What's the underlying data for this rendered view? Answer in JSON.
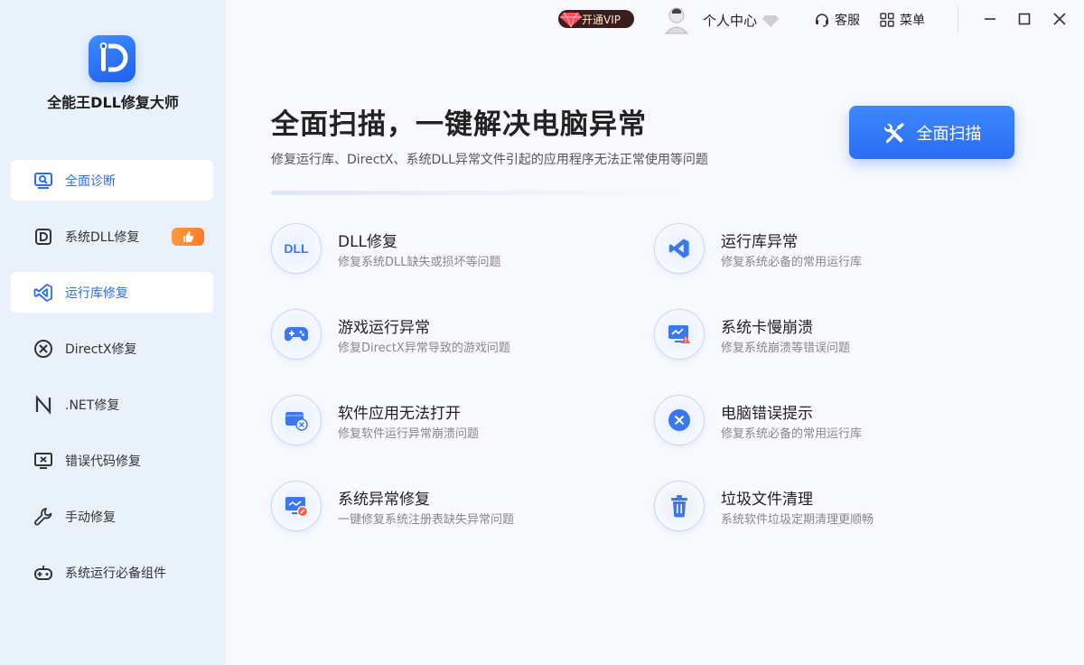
{
  "app": {
    "name": "全能王DLL修复大师"
  },
  "sidebar": {
    "items": [
      {
        "label": "全面诊断",
        "icon": "scan-icon"
      },
      {
        "label": "系统DLL修复",
        "icon": "dll-icon"
      },
      {
        "label": "运行库修复",
        "icon": "vs-icon"
      },
      {
        "label": "DirectX修复",
        "icon": "directx-icon"
      },
      {
        "label": ".NET修复",
        "icon": "dotnet-icon"
      },
      {
        "label": "错误代码修复",
        "icon": "monitor-error-icon"
      },
      {
        "label": "手动修复",
        "icon": "wrench-icon"
      },
      {
        "label": "系统运行必备组件",
        "icon": "gamepad-icon"
      }
    ]
  },
  "topbar": {
    "vip_label": "开通VIP",
    "user_center": "个人中心",
    "service": "客服",
    "menu": "菜单"
  },
  "main": {
    "headline": "全面扫描，一键解决电脑异常",
    "subline": "修复运行库、DirectX、系统DLL异常文件引起的应用程序无法正常使用等问题",
    "scan_button": "全面扫描",
    "features": [
      {
        "title": "DLL修复",
        "desc": "修复系统DLL缺失或损坏等问题",
        "icon": "dll-text-icon",
        "icon_text": "DLL"
      },
      {
        "title": "运行库异常",
        "desc": "修复系统必备的常用运行库",
        "icon": "vs-icon"
      },
      {
        "title": "游戏运行异常",
        "desc": "修复DirectX异常导致的游戏问题",
        "icon": "gamepad-icon"
      },
      {
        "title": "系统卡慢崩溃",
        "desc": "修复系统崩溃等错误问题",
        "icon": "monitor-warning-icon"
      },
      {
        "title": "软件应用无法打开",
        "desc": "修复软件运行异常崩溃问题",
        "icon": "app-error-icon"
      },
      {
        "title": "电脑错误提示",
        "desc": "修复系统必备的常用运行库",
        "icon": "close-circle-icon"
      },
      {
        "title": "系统异常修复",
        "desc": "一键修复系统注册表缺失异常问题",
        "icon": "registry-repair-icon"
      },
      {
        "title": "垃圾文件清理",
        "desc": "系统软件垃圾定期清理更顺畅",
        "icon": "trash-icon"
      }
    ]
  },
  "colors": {
    "accent": "#2a6df4",
    "sidebar_bg": "#e9f1fb",
    "badge_orange": "#ff8a30"
  }
}
